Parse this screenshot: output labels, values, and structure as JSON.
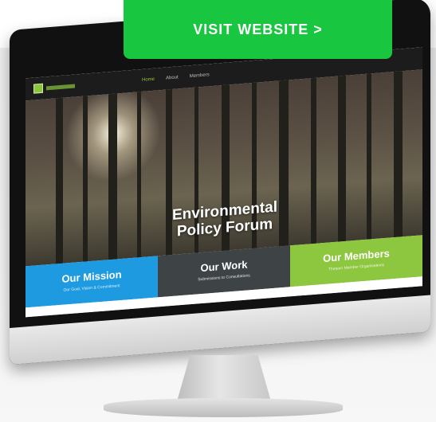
{
  "cta": {
    "label": "VISIT WEBSITE >"
  },
  "site": {
    "nav": [
      {
        "label": "Home",
        "active": true
      },
      {
        "label": "About",
        "active": false
      },
      {
        "label": "Members",
        "active": false
      }
    ],
    "hero_title_line1": "Environmental",
    "hero_title_line2": "Policy Forum",
    "panels": [
      {
        "title": "Our Mission",
        "subtitle": "Our Goal, Vision & Commitment",
        "color": "#1e9be0"
      },
      {
        "title": "Our Work",
        "subtitle": "Submissions to Consultations",
        "color": "#3e4446"
      },
      {
        "title": "Our Members",
        "subtitle": "Thirteen Member Organisations",
        "color": "#8dc63f"
      }
    ]
  },
  "colors": {
    "cta": "#19c640",
    "accent_green": "#8cc63f"
  }
}
